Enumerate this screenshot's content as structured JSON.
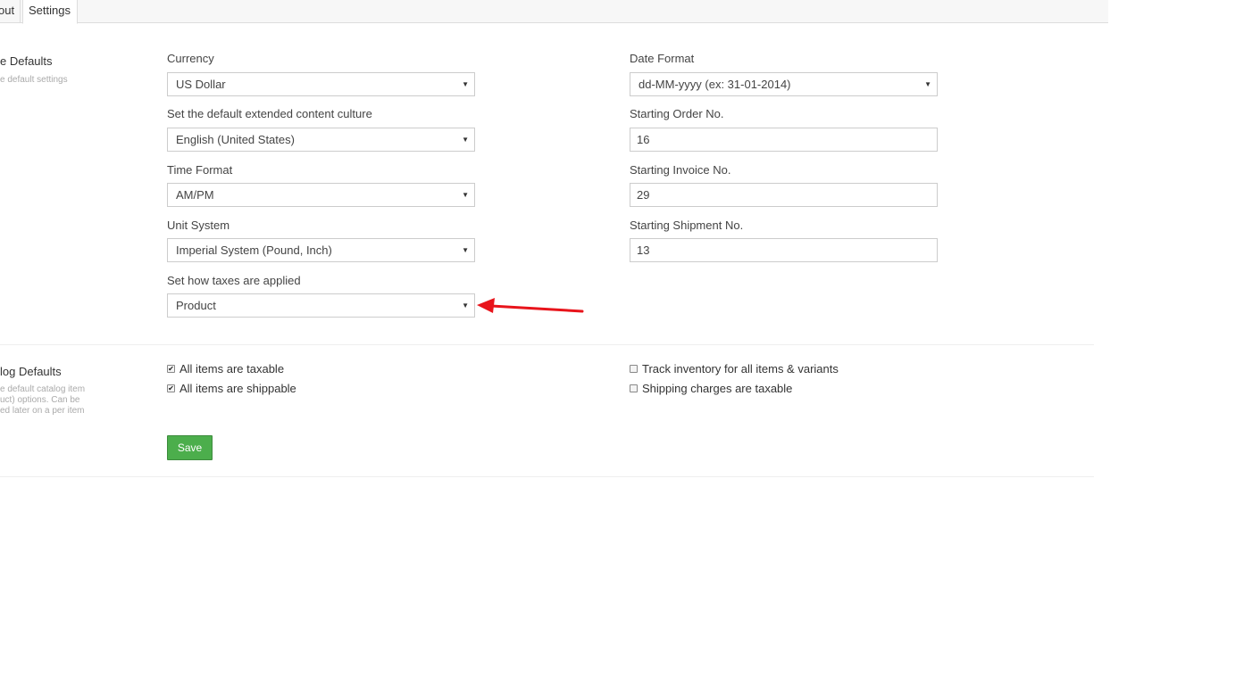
{
  "tabs": [
    {
      "label": "out"
    },
    {
      "label": "Settings"
    }
  ],
  "sections": {
    "store_defaults": {
      "title": "e Defaults",
      "description": [
        "e default settings"
      ]
    },
    "catalog_defaults": {
      "title": "log Defaults",
      "description": [
        "e default catalog item",
        "uct) options. Can be",
        "ed later on a per item"
      ]
    }
  },
  "fields": {
    "currency": {
      "label": "Currency",
      "value": "US Dollar"
    },
    "culture": {
      "label": "Set the default extended content culture",
      "value": "English (United States)"
    },
    "time_format": {
      "label": "Time Format",
      "value": "AM/PM"
    },
    "unit_system": {
      "label": "Unit System",
      "value": "Imperial System (Pound, Inch)"
    },
    "taxes_applied": {
      "label": "Set how taxes are applied",
      "value": "Product"
    },
    "date_format": {
      "label": "Date Format",
      "value": "dd-MM-yyyy (ex: 31-01-2014)"
    },
    "starting_order": {
      "label": "Starting Order No.",
      "value": "16"
    },
    "starting_invoice": {
      "label": "Starting Invoice No.",
      "value": "29"
    },
    "starting_shipment": {
      "label": "Starting Shipment No.",
      "value": "13"
    }
  },
  "checkboxes": {
    "taxable": {
      "label": "All items are taxable",
      "checked": true,
      "mark": "✔"
    },
    "shippable": {
      "label": "All items are shippable",
      "checked": true,
      "mark": "✔"
    },
    "track_inventory": {
      "label": "Track inventory for all items & variants",
      "checked": false,
      "mark": ""
    },
    "shipping_taxable": {
      "label": "Shipping charges are taxable",
      "checked": false,
      "mark": ""
    }
  },
  "actions": {
    "save_label": "Save"
  },
  "annotation": {
    "arrow_color": "#e8141b"
  },
  "icons": {
    "caret": "▼"
  }
}
